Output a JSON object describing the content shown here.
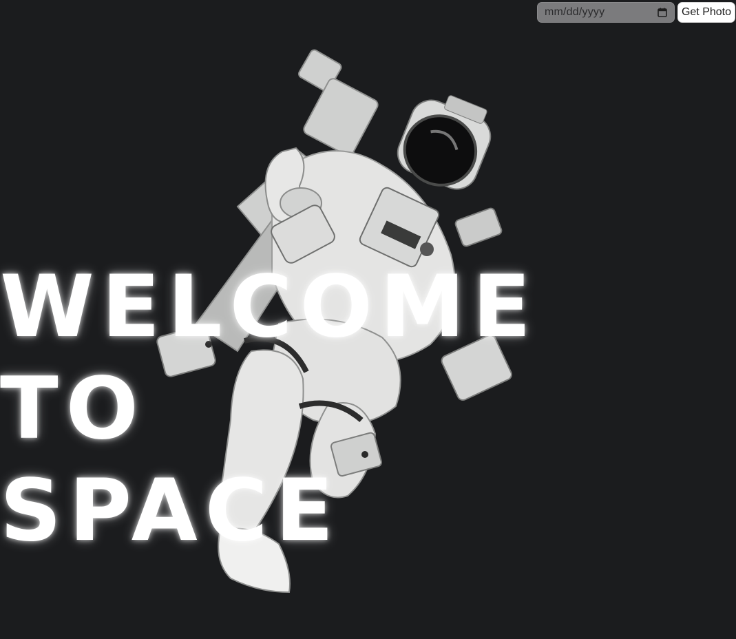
{
  "controls": {
    "date_placeholder": "mm/dd/yyyy",
    "date_icon": "calendar-icon",
    "button_label": "Get Photo"
  },
  "hero": {
    "line1": "WELCOME",
    "line2": "TO",
    "line3": "SPACE",
    "image": "astronaut-photo"
  },
  "colors": {
    "background": "#1b1c1e",
    "headline": "#ffffff",
    "date_input_bg": "#7b7b7d",
    "button_bg": "#ffffff"
  }
}
